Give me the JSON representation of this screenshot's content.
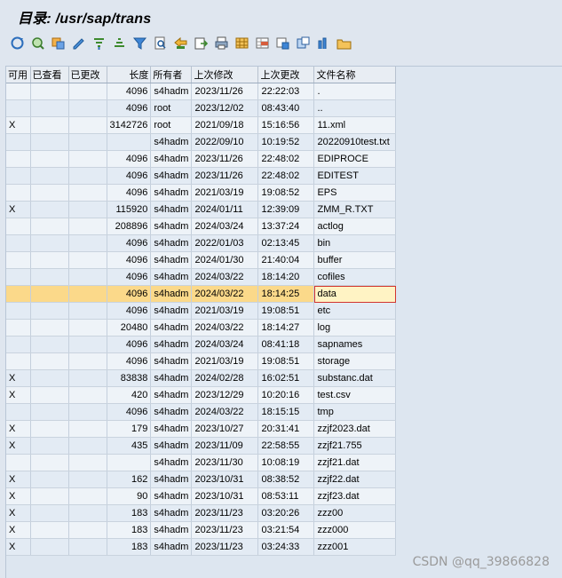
{
  "title": "目录: /usr/sap/trans",
  "toolbar": {
    "icons": [
      "refresh-icon",
      "display-icon",
      "view-settings-icon",
      "edit-icon",
      "sort-ascending-icon",
      "sort-descending-icon",
      "filter-icon",
      "find-icon",
      "first-page-icon",
      "export-icon",
      "print-icon",
      "layout-icon",
      "select-layout-icon",
      "save-layout-icon",
      "local-file-icon",
      "graphic-icon",
      "open-folder-icon"
    ]
  },
  "columns": [
    "可用",
    "已查看",
    "已更改",
    "长度",
    "所有者",
    "上次修改",
    "上次更改",
    "文件名称"
  ],
  "rows": [
    {
      "avail": "",
      "viewed": "",
      "changed": "",
      "length": "4096",
      "owner": "s4hadm",
      "date": "2023/11/26",
      "time": "22:22:03",
      "name": "."
    },
    {
      "avail": "",
      "viewed": "",
      "changed": "",
      "length": "4096",
      "owner": "root",
      "date": "2023/12/02",
      "time": "08:43:40",
      "name": ".."
    },
    {
      "avail": "X",
      "viewed": "",
      "changed": "",
      "length": "3142726",
      "owner": "root",
      "date": "2021/09/18",
      "time": "15:16:56",
      "name": "11.xml"
    },
    {
      "avail": "",
      "viewed": "",
      "changed": "",
      "length": "",
      "owner": "s4hadm",
      "date": "2022/09/10",
      "time": "10:19:52",
      "name": "20220910test.txt"
    },
    {
      "avail": "",
      "viewed": "",
      "changed": "",
      "length": "4096",
      "owner": "s4hadm",
      "date": "2023/11/26",
      "time": "22:48:02",
      "name": "EDIPROCE"
    },
    {
      "avail": "",
      "viewed": "",
      "changed": "",
      "length": "4096",
      "owner": "s4hadm",
      "date": "2023/11/26",
      "time": "22:48:02",
      "name": "EDITEST"
    },
    {
      "avail": "",
      "viewed": "",
      "changed": "",
      "length": "4096",
      "owner": "s4hadm",
      "date": "2021/03/19",
      "time": "19:08:52",
      "name": "EPS"
    },
    {
      "avail": "X",
      "viewed": "",
      "changed": "",
      "length": "115920",
      "owner": "s4hadm",
      "date": "2024/01/11",
      "time": "12:39:09",
      "name": "ZMM_R.TXT"
    },
    {
      "avail": "",
      "viewed": "",
      "changed": "",
      "length": "208896",
      "owner": "s4hadm",
      "date": "2024/03/24",
      "time": "13:37:24",
      "name": "actlog"
    },
    {
      "avail": "",
      "viewed": "",
      "changed": "",
      "length": "4096",
      "owner": "s4hadm",
      "date": "2022/01/03",
      "time": "02:13:45",
      "name": "bin"
    },
    {
      "avail": "",
      "viewed": "",
      "changed": "",
      "length": "4096",
      "owner": "s4hadm",
      "date": "2024/01/30",
      "time": "21:40:04",
      "name": "buffer"
    },
    {
      "avail": "",
      "viewed": "",
      "changed": "",
      "length": "4096",
      "owner": "s4hadm",
      "date": "2024/03/22",
      "time": "18:14:20",
      "name": "cofiles"
    },
    {
      "avail": "",
      "viewed": "",
      "changed": "",
      "length": "4096",
      "owner": "s4hadm",
      "date": "2024/03/22",
      "time": "18:14:25",
      "name": "data"
    },
    {
      "avail": "",
      "viewed": "",
      "changed": "",
      "length": "4096",
      "owner": "s4hadm",
      "date": "2021/03/19",
      "time": "19:08:51",
      "name": "etc"
    },
    {
      "avail": "",
      "viewed": "",
      "changed": "",
      "length": "20480",
      "owner": "s4hadm",
      "date": "2024/03/22",
      "time": "18:14:27",
      "name": "log"
    },
    {
      "avail": "",
      "viewed": "",
      "changed": "",
      "length": "4096",
      "owner": "s4hadm",
      "date": "2024/03/24",
      "time": "08:41:18",
      "name": "sapnames"
    },
    {
      "avail": "",
      "viewed": "",
      "changed": "",
      "length": "4096",
      "owner": "s4hadm",
      "date": "2021/03/19",
      "time": "19:08:51",
      "name": "storage"
    },
    {
      "avail": "X",
      "viewed": "",
      "changed": "",
      "length": "83838",
      "owner": "s4hadm",
      "date": "2024/02/28",
      "time": "16:02:51",
      "name": "substanc.dat"
    },
    {
      "avail": "X",
      "viewed": "",
      "changed": "",
      "length": "420",
      "owner": "s4hadm",
      "date": "2023/12/29",
      "time": "10:20:16",
      "name": "test.csv"
    },
    {
      "avail": "",
      "viewed": "",
      "changed": "",
      "length": "4096",
      "owner": "s4hadm",
      "date": "2024/03/22",
      "time": "18:15:15",
      "name": "tmp"
    },
    {
      "avail": "X",
      "viewed": "",
      "changed": "",
      "length": "179",
      "owner": "s4hadm",
      "date": "2023/10/27",
      "time": "20:31:41",
      "name": "zzjf2023.dat"
    },
    {
      "avail": "X",
      "viewed": "",
      "changed": "",
      "length": "435",
      "owner": "s4hadm",
      "date": "2023/11/09",
      "time": "22:58:55",
      "name": "zzjf21.755"
    },
    {
      "avail": "",
      "viewed": "",
      "changed": "",
      "length": "",
      "owner": "s4hadm",
      "date": "2023/11/30",
      "time": "10:08:19",
      "name": "zzjf21.dat"
    },
    {
      "avail": "X",
      "viewed": "",
      "changed": "",
      "length": "162",
      "owner": "s4hadm",
      "date": "2023/10/31",
      "time": "08:38:52",
      "name": "zzjf22.dat"
    },
    {
      "avail": "X",
      "viewed": "",
      "changed": "",
      "length": "90",
      "owner": "s4hadm",
      "date": "2023/10/31",
      "time": "08:53:11",
      "name": "zzjf23.dat"
    },
    {
      "avail": "X",
      "viewed": "",
      "changed": "",
      "length": "183",
      "owner": "s4hadm",
      "date": "2023/11/23",
      "time": "03:20:26",
      "name": "zzz00"
    },
    {
      "avail": "X",
      "viewed": "",
      "changed": "",
      "length": "183",
      "owner": "s4hadm",
      "date": "2023/11/23",
      "time": "03:21:54",
      "name": "zzz000"
    },
    {
      "avail": "X",
      "viewed": "",
      "changed": "",
      "length": "183",
      "owner": "s4hadm",
      "date": "2023/11/23",
      "time": "03:24:33",
      "name": "zzz001"
    }
  ],
  "selected_row_index": 12,
  "watermark": "CSDN @qq_39866828",
  "colors": {
    "background": "#dfe6ef",
    "selected_row": "#fbd98a",
    "selected_cell_border": "#d2352f"
  }
}
